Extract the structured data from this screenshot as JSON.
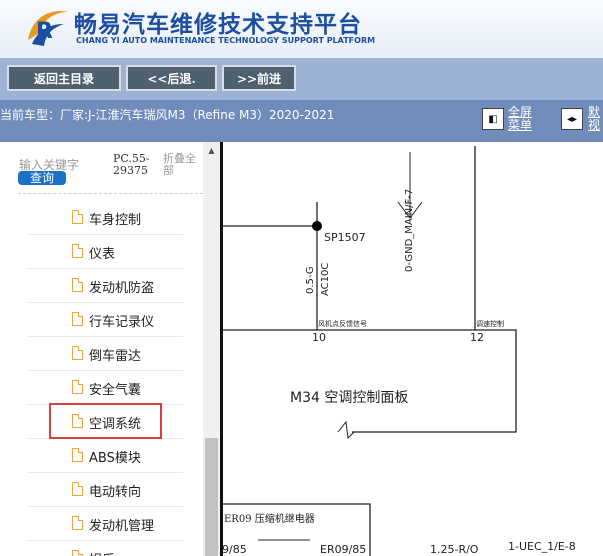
{
  "header": {
    "title": "畅易汽车维修技术支持平台",
    "subtitle": "CHANG YI AUTO MAINTENANCE TECHNOLOGY SUPPORT PLATFORM",
    "logo_icon": "swoosh-logo",
    "brand_color": "#1c4ea2"
  },
  "toolbar": {
    "back_main": "返回主目录",
    "back": "<<后退.",
    "forward": ">>前进"
  },
  "infobar": {
    "vehicle": "当前车型：厂家:J-江淮汽车瑞风M3（Refine M3）2020-2021",
    "fullscreen_line1": "全屏",
    "fullscreen_line2": "菜单",
    "default_line1": "默",
    "default_line2": "视"
  },
  "sidebar": {
    "search_placeholder": "输入关键字",
    "query": "查询",
    "pc_code": "PC.55-29375",
    "collapse": "折叠全部",
    "items": [
      {
        "label": "车身控制"
      },
      {
        "label": "仪表"
      },
      {
        "label": "发动机防盗"
      },
      {
        "label": "行车记录仪"
      },
      {
        "label": "倒车雷达"
      },
      {
        "label": "安全气囊"
      },
      {
        "label": "空调系统"
      },
      {
        "label": "ABS模块"
      },
      {
        "label": "电动转向"
      },
      {
        "label": "发动机管理"
      },
      {
        "label": "娱乐"
      }
    ],
    "selected_label": "空调系统"
  },
  "diagram": {
    "gnd_label": "0-GND_MAIN/F-7",
    "splice": "SP1507",
    "wire_size": "0.5-G",
    "wire_name": "AC10C",
    "pin_left_desc": "风机点反馈信号",
    "pin_left": "10",
    "pin_right_desc": "调速控制",
    "pin_right": "12",
    "module": "M34  空调控制面板",
    "relay": "ER09  压缩机继电器",
    "relay_pin_left": "9/85",
    "relay_pin": "ER09/85",
    "wire2": "1.25-R/O",
    "connector": "1-UEC_1/E-8"
  }
}
